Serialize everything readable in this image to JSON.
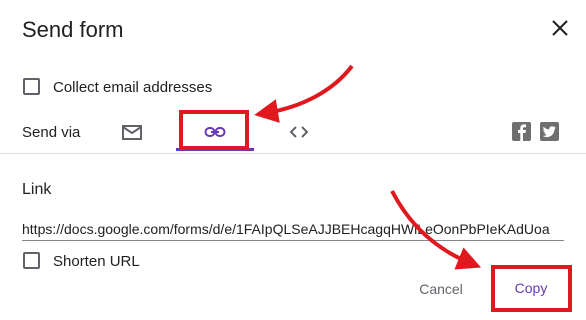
{
  "dialog": {
    "title": "Send form",
    "collect_label": "Collect email addresses",
    "send_via_label": "Send via",
    "link_section_label": "Link",
    "link_url": "https://docs.google.com/forms/d/e/1FAIpQLSeAJJBEHcagqHWlLeOonPbPIeKAdUoa",
    "shorten_label": "Shorten URL",
    "cancel_label": "Cancel",
    "copy_label": "Copy"
  },
  "icons": {
    "close": "close-icon",
    "email": "email-icon",
    "link": "link-icon",
    "embed": "embed-icon",
    "facebook": "facebook-icon",
    "twitter": "twitter-icon"
  },
  "colors": {
    "accent": "#673ab7",
    "annotation": "#e0191f",
    "text": "#202124",
    "muted": "#5f6368"
  }
}
